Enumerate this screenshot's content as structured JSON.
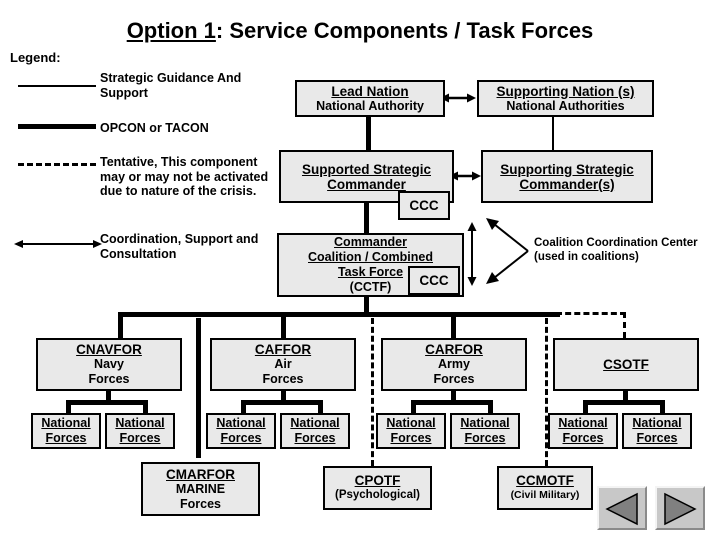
{
  "slide": {
    "title_underlined": "Option 1",
    "title_rest": ":  Service Components / Task Forces"
  },
  "legend": {
    "heading": "Legend:",
    "items": [
      {
        "style": "thin-line",
        "label_line1": "Strategic Guidance",
        "label_line2": "And Support"
      },
      {
        "style": "thick-line",
        "label_line1": "OPCON or TACON",
        "label_line2": ""
      },
      {
        "style": "dashed-line",
        "label_line1": "Tentative, This component",
        "label_line2": "may or may not be",
        "label_line3": "activated due to nature of",
        "label_line4": "the crisis."
      },
      {
        "style": "double-arrow",
        "label_line1": "Coordination, Support",
        "label_line2": "and Consultation"
      }
    ]
  },
  "annotations": {
    "ccc_note_line1": "Coalition Coordination",
    "ccc_note_line2": "Center (used in",
    "ccc_note_line3": "coalitions)"
  },
  "nodes": {
    "lead_nation": {
      "title": "Lead Nation",
      "sub1": "National Authority"
    },
    "supporting_nation": {
      "title": "Supporting Nation (s)",
      "sub1": "National Authorities"
    },
    "supported_strategic": {
      "title1": "Supported Strategic",
      "title2": "Commander"
    },
    "supporting_strategic": {
      "title1": "Supporting Strategic",
      "title2": "Commander(s)"
    },
    "ccc_upper": {
      "title": "CCC"
    },
    "ccc_lower": {
      "title": "CCC"
    },
    "cctf": {
      "title1": "Commander",
      "title2": "Coalition / Combined",
      "title3": "Task Force",
      "sub1": "(CCTF)"
    },
    "cnavfor": {
      "title": "CNAVFOR",
      "sub1": "Navy",
      "sub2": "Forces"
    },
    "caffor": {
      "title": "CAFFOR",
      "sub1": "Air",
      "sub2": "Forces"
    },
    "carfor": {
      "title": "CARFOR",
      "sub1": "Army",
      "sub2": "Forces"
    },
    "csotf": {
      "title": "CSOTF"
    },
    "cmarfor": {
      "title": "CMARFOR",
      "sub1": "MARINE",
      "sub2": "Forces"
    },
    "cpotf": {
      "title": "CPOTF",
      "sub1": "(Psychological)"
    },
    "ccmotf": {
      "title": "CCMOTF",
      "sub1": "(Civil Military)"
    },
    "national_forces": {
      "line1": "National",
      "line2": "Forces",
      "instances": [
        "cnavfor-left",
        "cnavfor-right",
        "caffor-left",
        "caffor-right",
        "carfor-left",
        "carfor-right",
        "csotf-left",
        "csotf-right"
      ]
    }
  },
  "nav": {
    "prev_icon": "triangle-left-icon",
    "next_icon": "triangle-right-icon"
  },
  "colors": {
    "box_fill": "#e9e9e9",
    "box_border": "#000000",
    "button_face": "#c8c8c8",
    "triangle_fill": "#808080",
    "background": "#ffffff"
  }
}
